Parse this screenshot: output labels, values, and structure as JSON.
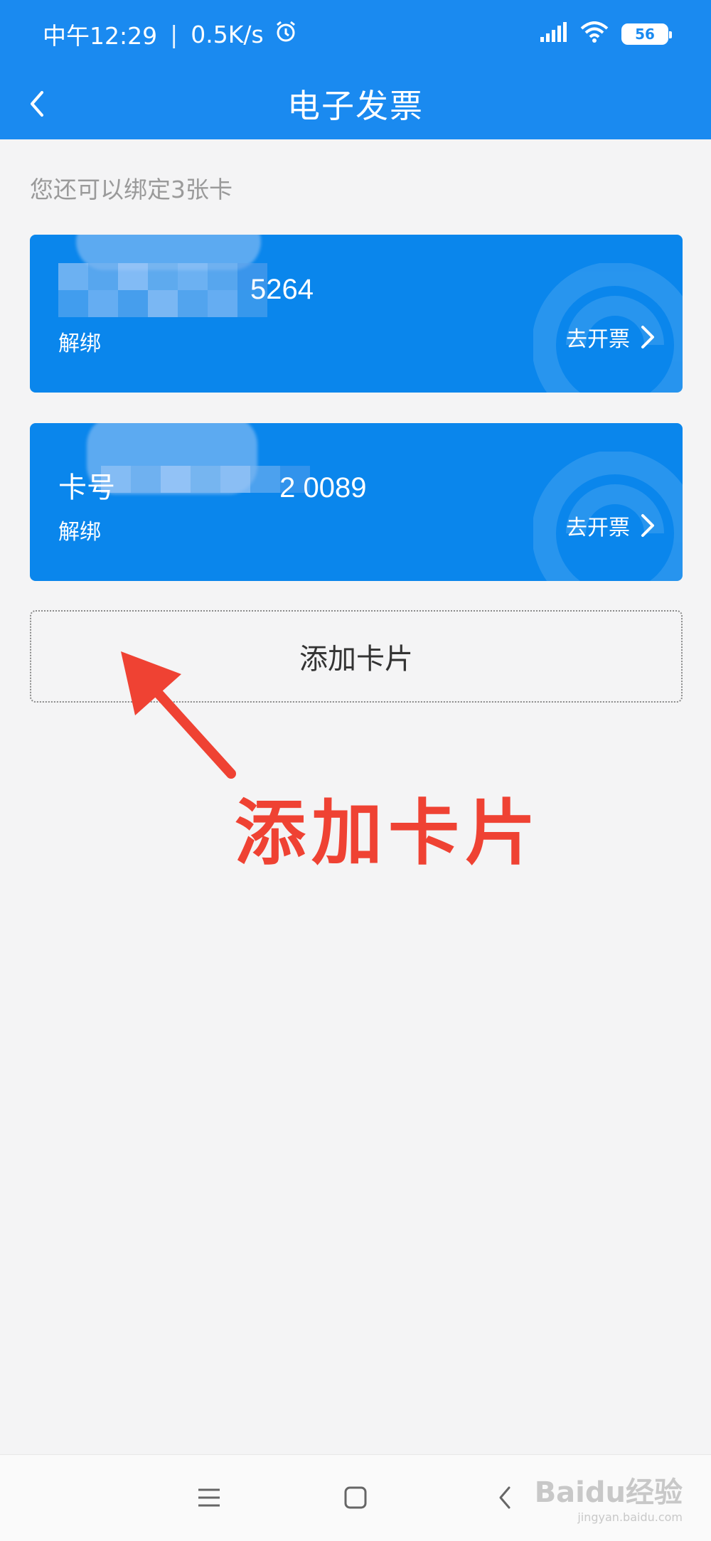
{
  "status_bar": {
    "time": "中午12:29",
    "separator": "|",
    "speed": "0.5K/s",
    "battery": "56"
  },
  "header": {
    "title": "电子发票"
  },
  "hint": "您还可以绑定3张卡",
  "cards": [
    {
      "number_prefix": "",
      "number_suffix": "5264",
      "unbind_label": "解绑",
      "invoice_label": "去开票"
    },
    {
      "number_prefix": "卡号",
      "number_suffix": "2 0089",
      "unbind_label": "解绑",
      "invoice_label": "去开票"
    }
  ],
  "add_card_label": "添加卡片",
  "annotation": "添加卡片",
  "watermark": {
    "brand": "Baidu经验",
    "url": "jingyan.baidu.com"
  },
  "colors": {
    "primary": "#1a8af0",
    "card": "#0a86ec",
    "background": "#f4f4f5",
    "annotation": "#ef4233"
  }
}
